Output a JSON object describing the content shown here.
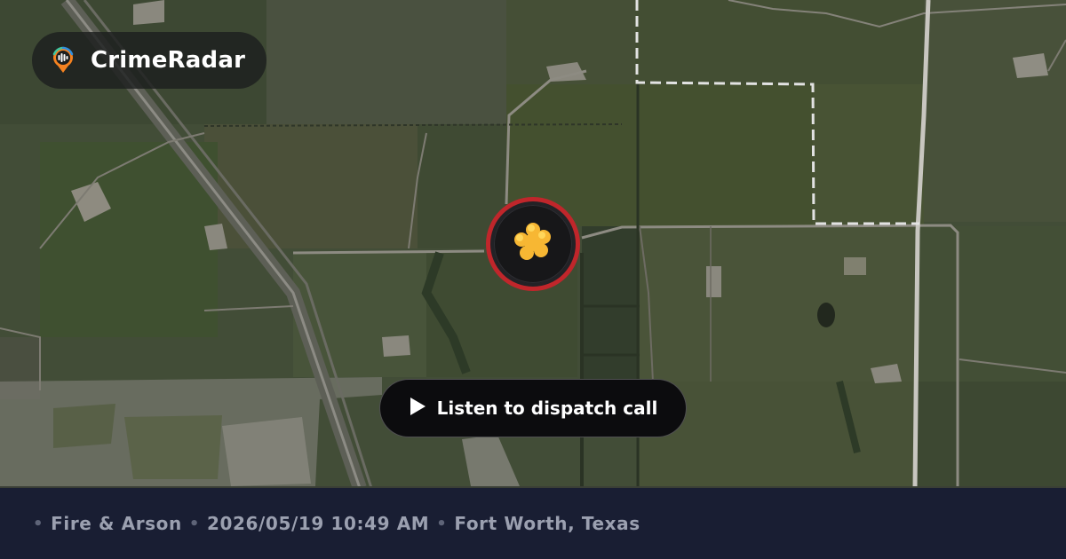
{
  "brand": {
    "name": "CrimeRadar",
    "icon": "radar-pin-icon"
  },
  "incident": {
    "category_icon": "fire-icon",
    "marker_color": "#c0262b"
  },
  "listen_button": {
    "label": "Listen to dispatch call",
    "icon": "play-icon"
  },
  "footer": {
    "separator": "•",
    "category": "Fire & Arson",
    "datetime": "2026/05/19 10:49 AM",
    "location": "Fort Worth, Texas"
  }
}
